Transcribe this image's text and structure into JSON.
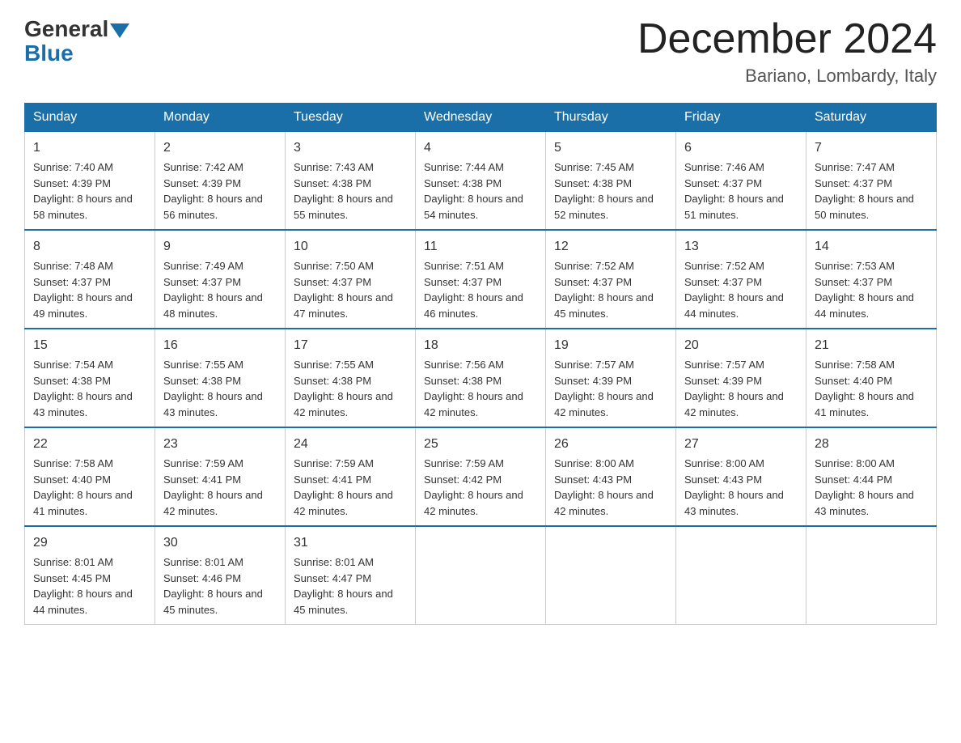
{
  "header": {
    "logo_general": "General",
    "logo_blue": "Blue",
    "month_title": "December 2024",
    "location": "Bariano, Lombardy, Italy"
  },
  "days_of_week": [
    "Sunday",
    "Monday",
    "Tuesday",
    "Wednesday",
    "Thursday",
    "Friday",
    "Saturday"
  ],
  "weeks": [
    [
      {
        "day": "1",
        "sunrise": "7:40 AM",
        "sunset": "4:39 PM",
        "daylight": "8 hours and 58 minutes."
      },
      {
        "day": "2",
        "sunrise": "7:42 AM",
        "sunset": "4:39 PM",
        "daylight": "8 hours and 56 minutes."
      },
      {
        "day": "3",
        "sunrise": "7:43 AM",
        "sunset": "4:38 PM",
        "daylight": "8 hours and 55 minutes."
      },
      {
        "day": "4",
        "sunrise": "7:44 AM",
        "sunset": "4:38 PM",
        "daylight": "8 hours and 54 minutes."
      },
      {
        "day": "5",
        "sunrise": "7:45 AM",
        "sunset": "4:38 PM",
        "daylight": "8 hours and 52 minutes."
      },
      {
        "day": "6",
        "sunrise": "7:46 AM",
        "sunset": "4:37 PM",
        "daylight": "8 hours and 51 minutes."
      },
      {
        "day": "7",
        "sunrise": "7:47 AM",
        "sunset": "4:37 PM",
        "daylight": "8 hours and 50 minutes."
      }
    ],
    [
      {
        "day": "8",
        "sunrise": "7:48 AM",
        "sunset": "4:37 PM",
        "daylight": "8 hours and 49 minutes."
      },
      {
        "day": "9",
        "sunrise": "7:49 AM",
        "sunset": "4:37 PM",
        "daylight": "8 hours and 48 minutes."
      },
      {
        "day": "10",
        "sunrise": "7:50 AM",
        "sunset": "4:37 PM",
        "daylight": "8 hours and 47 minutes."
      },
      {
        "day": "11",
        "sunrise": "7:51 AM",
        "sunset": "4:37 PM",
        "daylight": "8 hours and 46 minutes."
      },
      {
        "day": "12",
        "sunrise": "7:52 AM",
        "sunset": "4:37 PM",
        "daylight": "8 hours and 45 minutes."
      },
      {
        "day": "13",
        "sunrise": "7:52 AM",
        "sunset": "4:37 PM",
        "daylight": "8 hours and 44 minutes."
      },
      {
        "day": "14",
        "sunrise": "7:53 AM",
        "sunset": "4:37 PM",
        "daylight": "8 hours and 44 minutes."
      }
    ],
    [
      {
        "day": "15",
        "sunrise": "7:54 AM",
        "sunset": "4:38 PM",
        "daylight": "8 hours and 43 minutes."
      },
      {
        "day": "16",
        "sunrise": "7:55 AM",
        "sunset": "4:38 PM",
        "daylight": "8 hours and 43 minutes."
      },
      {
        "day": "17",
        "sunrise": "7:55 AM",
        "sunset": "4:38 PM",
        "daylight": "8 hours and 42 minutes."
      },
      {
        "day": "18",
        "sunrise": "7:56 AM",
        "sunset": "4:38 PM",
        "daylight": "8 hours and 42 minutes."
      },
      {
        "day": "19",
        "sunrise": "7:57 AM",
        "sunset": "4:39 PM",
        "daylight": "8 hours and 42 minutes."
      },
      {
        "day": "20",
        "sunrise": "7:57 AM",
        "sunset": "4:39 PM",
        "daylight": "8 hours and 42 minutes."
      },
      {
        "day": "21",
        "sunrise": "7:58 AM",
        "sunset": "4:40 PM",
        "daylight": "8 hours and 41 minutes."
      }
    ],
    [
      {
        "day": "22",
        "sunrise": "7:58 AM",
        "sunset": "4:40 PM",
        "daylight": "8 hours and 41 minutes."
      },
      {
        "day": "23",
        "sunrise": "7:59 AM",
        "sunset": "4:41 PM",
        "daylight": "8 hours and 42 minutes."
      },
      {
        "day": "24",
        "sunrise": "7:59 AM",
        "sunset": "4:41 PM",
        "daylight": "8 hours and 42 minutes."
      },
      {
        "day": "25",
        "sunrise": "7:59 AM",
        "sunset": "4:42 PM",
        "daylight": "8 hours and 42 minutes."
      },
      {
        "day": "26",
        "sunrise": "8:00 AM",
        "sunset": "4:43 PM",
        "daylight": "8 hours and 42 minutes."
      },
      {
        "day": "27",
        "sunrise": "8:00 AM",
        "sunset": "4:43 PM",
        "daylight": "8 hours and 43 minutes."
      },
      {
        "day": "28",
        "sunrise": "8:00 AM",
        "sunset": "4:44 PM",
        "daylight": "8 hours and 43 minutes."
      }
    ],
    [
      {
        "day": "29",
        "sunrise": "8:01 AM",
        "sunset": "4:45 PM",
        "daylight": "8 hours and 44 minutes."
      },
      {
        "day": "30",
        "sunrise": "8:01 AM",
        "sunset": "4:46 PM",
        "daylight": "8 hours and 45 minutes."
      },
      {
        "day": "31",
        "sunrise": "8:01 AM",
        "sunset": "4:47 PM",
        "daylight": "8 hours and 45 minutes."
      },
      null,
      null,
      null,
      null
    ]
  ],
  "labels": {
    "sunrise": "Sunrise:",
    "sunset": "Sunset:",
    "daylight": "Daylight:"
  }
}
